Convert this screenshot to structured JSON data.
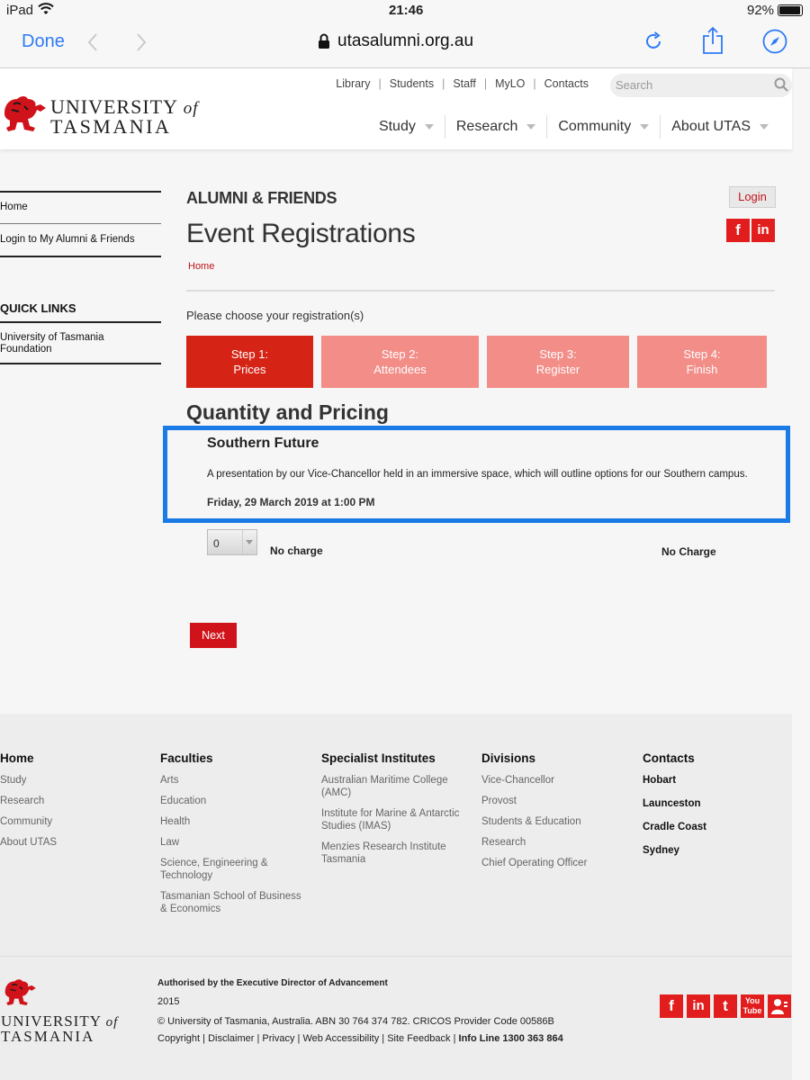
{
  "status": {
    "device": "iPad",
    "time": "21:46",
    "battery": "92%"
  },
  "browser": {
    "done": "Done",
    "url": "utasalumni.org.au"
  },
  "header": {
    "logo_line1": "UNIVERSITY",
    "logo_of": "of",
    "logo_line2": "TASMANIA",
    "top_links": [
      "Library",
      "Students",
      "Staff",
      "MyLO",
      "Contacts"
    ],
    "search_placeholder": "Search",
    "nav": [
      "Study",
      "Research",
      "Community",
      "About UTAS"
    ]
  },
  "sidebar": {
    "links": [
      "Home",
      "Login to My Alumni & Friends"
    ],
    "quick_links_title": "QUICK LINKS",
    "quick_links": [
      "University of Tasmania Foundation"
    ]
  },
  "main": {
    "section": "ALUMNI & FRIENDS",
    "title": "Event Registrations",
    "breadcrumb": "Home",
    "login": "Login",
    "instruction": "Please choose your registration(s)",
    "steps": [
      {
        "line1": "Step 1:",
        "line2": "Prices"
      },
      {
        "line1": "Step 2:",
        "line2": "Attendees"
      },
      {
        "line1": "Step 3:",
        "line2": "Register"
      },
      {
        "line1": "Step 4:",
        "line2": "Finish"
      }
    ],
    "quantity_heading": "Quantity and Pricing",
    "event": {
      "name": "Southern Future",
      "description": "A presentation by our Vice-Chancellor held in an immersive space, which will outline options for our Southern campus.",
      "date": "Friday, 29 March 2019 at 1:00 PM"
    },
    "quantity_value": "0",
    "charge_label": "No charge",
    "charge_total": "No Charge",
    "next": "Next"
  },
  "footer": {
    "columns": [
      {
        "title": "Home",
        "links": [
          "Study",
          "Research",
          "Community",
          "About UTAS"
        ]
      },
      {
        "title": "Faculties",
        "links": [
          "Arts",
          "Education",
          "Health",
          "Law",
          "Science, Engineering & Technology",
          "Tasmanian School of Business & Economics"
        ]
      },
      {
        "title": "Specialist Institutes",
        "links": [
          "Australian Maritime College (AMC)",
          "Institute for Marine & Antarctic Studies (IMAS)",
          "Menzies Research Institute Tasmania"
        ]
      },
      {
        "title": "Divisions",
        "links": [
          "Vice-Chancellor",
          "Provost",
          "Students & Education",
          "Research",
          "Chief Operating Officer"
        ]
      },
      {
        "title": "Contacts",
        "links": [
          "Hobart",
          "Launceston",
          "Cradle Coast",
          "Sydney"
        ]
      }
    ],
    "authorised": "Authorised by the Executive Director of Advancement",
    "year": "2015",
    "copyright": "© University of Tasmania, Australia. ABN 30 764 374 782. CRICOS Provider Code 00586B",
    "bottom_links": [
      "Copyright",
      "Disclaimer",
      "Privacy",
      "Web Accessibility",
      "Site Feedback"
    ],
    "info_line": "Info Line 1300 363 864",
    "social_icons": [
      "facebook-icon",
      "linkedin-icon",
      "twitter-icon",
      "youtube-icon",
      "profile-icon"
    ]
  },
  "colors": {
    "brand_red": "#d0131b",
    "step_inactive": "#f28d88",
    "highlight": "#1a7be6",
    "ios_blue": "#2f7bf5"
  }
}
